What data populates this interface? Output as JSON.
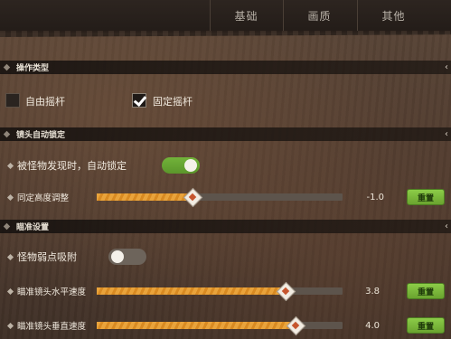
{
  "tabs": [
    "基础",
    "画质",
    "其他"
  ],
  "sections": {
    "operation": {
      "title": "操作类型"
    },
    "camera": {
      "title": "镜头自动锁定"
    },
    "aim": {
      "title": "瞄准设置"
    }
  },
  "operation": {
    "free_stick": {
      "label": "自由摇杆",
      "checked": false
    },
    "fixed_stick": {
      "label": "固定摇杆",
      "checked": true
    }
  },
  "camera": {
    "auto_lock": {
      "label": "被怪物发现时，自动锁定",
      "on": true
    },
    "lock_height": {
      "label": "同定高度调整",
      "value": "-1.0",
      "fraction": 0.39,
      "reset": "重置"
    }
  },
  "aim": {
    "weak_point": {
      "label": "怪物弱点吸附",
      "on": false
    },
    "horizontal": {
      "label": "瞄准镜头水平速度",
      "value": "3.8",
      "fraction": 0.77,
      "reset": "重置"
    },
    "vertical": {
      "label": "瞄准镜头垂直速度",
      "value": "4.0",
      "fraction": 0.81,
      "reset": "重置"
    }
  },
  "colors": {
    "accent_green": "#72b33a",
    "slider_orange": "#e9a33b",
    "reset_green": "#7dbb3e"
  }
}
